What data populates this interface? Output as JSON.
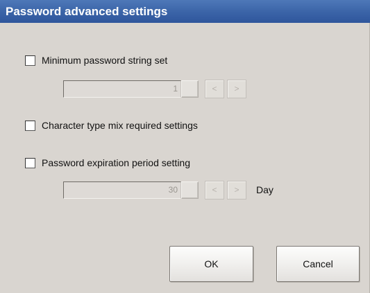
{
  "dialog": {
    "title": "Password advanced settings"
  },
  "minimum_length": {
    "label": "Minimum password string set",
    "checked": false,
    "value": "1",
    "decrement_label": "<",
    "increment_label": ">"
  },
  "character_mix": {
    "label": "Character type mix required settings",
    "checked": false
  },
  "expiration": {
    "label": "Password expiration period setting",
    "checked": false,
    "value": "30",
    "decrement_label": "<",
    "increment_label": ">",
    "unit": "Day"
  },
  "buttons": {
    "ok_label": "OK",
    "cancel_label": "Cancel"
  }
}
